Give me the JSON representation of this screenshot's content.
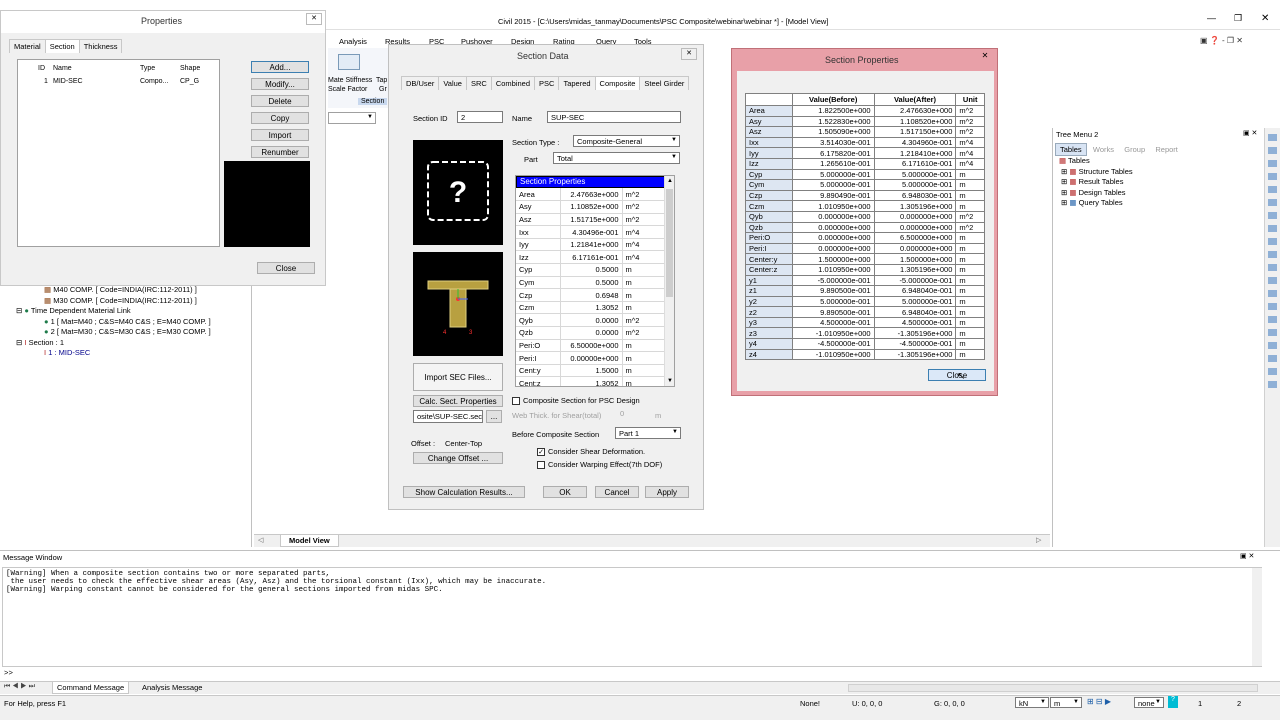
{
  "main_window": {
    "title": "Civil 2015 - [C:\\Users\\midas_tanmay\\Documents\\PSC Composite\\webinar\\webinar *] - [Model View]",
    "menu": [
      "Analysis",
      "Results",
      "PSC",
      "Pushover",
      "Design",
      "Rating",
      "Query",
      "Tools"
    ],
    "ribbon_items": [
      "Mate Stiffness",
      "Scale Factor",
      "Tap",
      "Gr",
      "Section"
    ],
    "model_view_tab": "Model View"
  },
  "properties": {
    "title": "Properties",
    "tabs": [
      "Material",
      "Section",
      "Thickness"
    ],
    "columns": [
      "ID",
      "Name",
      "Type",
      "Shape"
    ],
    "rows": [
      [
        "1",
        "MID-SEC",
        "Compo...",
        "CP_G"
      ]
    ],
    "buttons": [
      "Add...",
      "Modify...",
      "Delete",
      "Copy",
      "Import",
      "Renumber"
    ],
    "close": "Close"
  },
  "tree_left": [
    "M40 COMP. [ Code=INDIA(IRC:112-2011) ]",
    "M30 COMP. [ Code=INDIA(IRC:112-2011) ]",
    "Time Dependent Material Link",
    "1 [ Mat=M40 ; C&S=M40 C&S ; E=M40 COMP. ]",
    "2 [ Mat=M30 ; C&S=M30 C&S ; E=M30 COMP. ]",
    "Section : 1",
    "1 : MID-SEC"
  ],
  "section_data": {
    "title": "Section Data",
    "tabs": [
      "DB/User",
      "Value",
      "SRC",
      "Combined",
      "PSC",
      "Tapered",
      "Composite",
      "Steel Girder"
    ],
    "section_id_label": "Section ID",
    "section_id": "2",
    "name_label": "Name",
    "name": "SUP-SEC",
    "section_type_label": "Section Type :",
    "section_type": "Composite-General",
    "part_label": "Part",
    "part": "Total",
    "props_header": "Section Properties",
    "props": [
      [
        "Area",
        "2.47663e+000",
        "m^2"
      ],
      [
        "Asy",
        "1.10852e+000",
        "m^2"
      ],
      [
        "Asz",
        "1.51715e+000",
        "m^2"
      ],
      [
        "Ixx",
        "4.30496e-001",
        "m^4"
      ],
      [
        "Iyy",
        "1.21841e+000",
        "m^4"
      ],
      [
        "Izz",
        "6.17161e-001",
        "m^4"
      ],
      [
        "Cyp",
        "0.5000",
        "m"
      ],
      [
        "Cym",
        "0.5000",
        "m"
      ],
      [
        "Czp",
        "0.6948",
        "m"
      ],
      [
        "Czm",
        "1.3052",
        "m"
      ],
      [
        "Qyb",
        "0.0000",
        "m^2"
      ],
      [
        "Qzb",
        "0.0000",
        "m^2"
      ],
      [
        "Peri:O",
        "6.50000e+000",
        "m"
      ],
      [
        "Peri:I",
        "0.00000e+000",
        "m"
      ],
      [
        "Cent:y",
        "1.5000",
        "m"
      ],
      [
        "Cent:z",
        "1.3052",
        "m"
      ]
    ],
    "import_sec": "Import SEC Files...",
    "calc_sect": "Calc. Sect. Properties",
    "file_field": "osite\\SUP-SEC.sec",
    "browse": "...",
    "composite_psc": "Composite Section for PSC Design",
    "web_thick": "Web Thick. for Shear(total)",
    "web_thick_val": "0",
    "web_thick_unit": "m",
    "before_composite_label": "Before Composite Section",
    "before_composite": "Part 1",
    "offset_label": "Offset :",
    "offset": "Center-Top",
    "change_offset": "Change Offset ...",
    "shear_def": "Consider Shear Deformation.",
    "warping": "Consider Warping Effect(7th DOF)",
    "show_calc": "Show Calculation Results...",
    "ok": "OK",
    "cancel": "Cancel",
    "apply": "Apply"
  },
  "section_properties": {
    "title": "Section Properties",
    "columns": [
      "",
      "Value(Before)",
      "Value(After)",
      "Unit"
    ],
    "rows": [
      [
        "Area",
        "1.822500e+000",
        "2.476630e+000",
        "m^2"
      ],
      [
        "Asy",
        "1.522830e+000",
        "1.108520e+000",
        "m^2"
      ],
      [
        "Asz",
        "1.505090e+000",
        "1.517150e+000",
        "m^2"
      ],
      [
        "Ixx",
        "3.514030e-001",
        "4.304960e-001",
        "m^4"
      ],
      [
        "Iyy",
        "6.175820e-001",
        "1.218410e+000",
        "m^4"
      ],
      [
        "Izz",
        "1.265610e-001",
        "6.171610e-001",
        "m^4"
      ],
      [
        "Cyp",
        "5.000000e-001",
        "5.000000e-001",
        "m"
      ],
      [
        "Cym",
        "5.000000e-001",
        "5.000000e-001",
        "m"
      ],
      [
        "Czp",
        "9.890490e-001",
        "6.948030e-001",
        "m"
      ],
      [
        "Czm",
        "1.010950e+000",
        "1.305196e+000",
        "m"
      ],
      [
        "Qyb",
        "0.000000e+000",
        "0.000000e+000",
        "m^2"
      ],
      [
        "Qzb",
        "0.000000e+000",
        "0.000000e+000",
        "m^2"
      ],
      [
        "Peri:O",
        "0.000000e+000",
        "6.500000e+000",
        "m"
      ],
      [
        "Peri:I",
        "0.000000e+000",
        "0.000000e+000",
        "m"
      ],
      [
        "Center:y",
        "1.500000e+000",
        "1.500000e+000",
        "m"
      ],
      [
        "Center:z",
        "1.010950e+000",
        "1.305196e+000",
        "m"
      ],
      [
        "y1",
        "-5.000000e-001",
        "-5.000000e-001",
        "m"
      ],
      [
        "z1",
        "9.890500e-001",
        "6.948040e-001",
        "m"
      ],
      [
        "y2",
        "5.000000e-001",
        "5.000000e-001",
        "m"
      ],
      [
        "z2",
        "9.890500e-001",
        "6.948040e-001",
        "m"
      ],
      [
        "y3",
        "4.500000e-001",
        "4.500000e-001",
        "m"
      ],
      [
        "z3",
        "-1.010950e+000",
        "-1.305196e+000",
        "m"
      ],
      [
        "y4",
        "-4.500000e-001",
        "-4.500000e-001",
        "m"
      ],
      [
        "z4",
        "-1.010950e+000",
        "-1.305196e+000",
        "m"
      ]
    ],
    "close": "Close"
  },
  "tree_menu": {
    "title": "Tree Menu 2",
    "tabs": [
      "Tables",
      "Works",
      "Group",
      "Report"
    ],
    "root": "Tables",
    "items": [
      "Structure Tables",
      "Result Tables",
      "Design Tables",
      "Query Tables"
    ]
  },
  "message_window": {
    "title": "Message Window",
    "lines": [
      "[Warning] When a composite section contains two or more separated parts,",
      " the user needs to check the effective shear areas (Asy, Asz) and the torsional constant (Ixx), which may be inaccurate.",
      "[Warning] Warping constant cannot be considered for the general sections imported from midas SPC."
    ],
    "prompt": ">>",
    "tabs": [
      "Command Message",
      "Analysis Message"
    ]
  },
  "status_bar": {
    "help": "For Help, press F1",
    "none": "None!",
    "u": "U: 0, 0, 0",
    "g": "G: 0, 0, 0",
    "force_unit": "kN",
    "length_unit": "m",
    "none2": "none",
    "page": "1",
    "total": "2"
  },
  "colors": {
    "selection_blue": "#0000ff",
    "sec_props_frame": "#e8a0a8",
    "tree_blue": "#00008b"
  }
}
